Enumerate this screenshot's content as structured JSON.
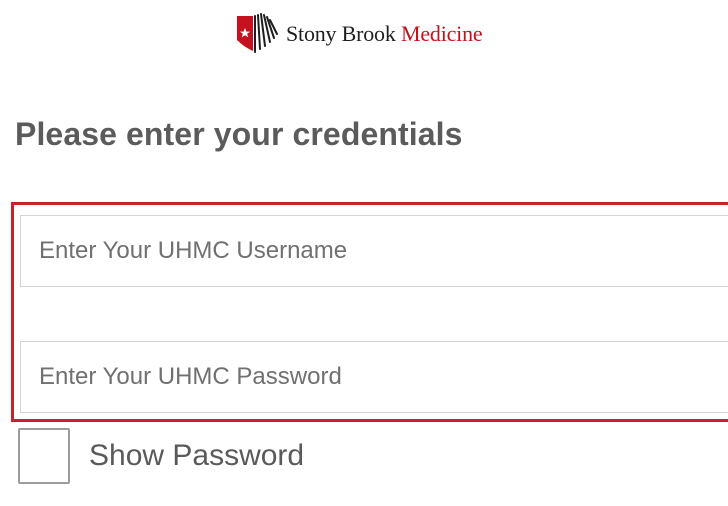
{
  "brand": {
    "name_primary": "Stony Brook",
    "name_accent": "Medicine",
    "accent_color": "#c4121f"
  },
  "heading": "Please enter your credentials",
  "form": {
    "username": {
      "placeholder": "Enter Your UHMC Username",
      "value": ""
    },
    "password": {
      "placeholder": "Enter Your UHMC Password",
      "value": ""
    },
    "highlight_color": "#c8202d"
  },
  "show_password": {
    "label": "Show Password",
    "checked": false
  },
  "icons": {
    "logo": "stony-brook-shield-icon"
  }
}
